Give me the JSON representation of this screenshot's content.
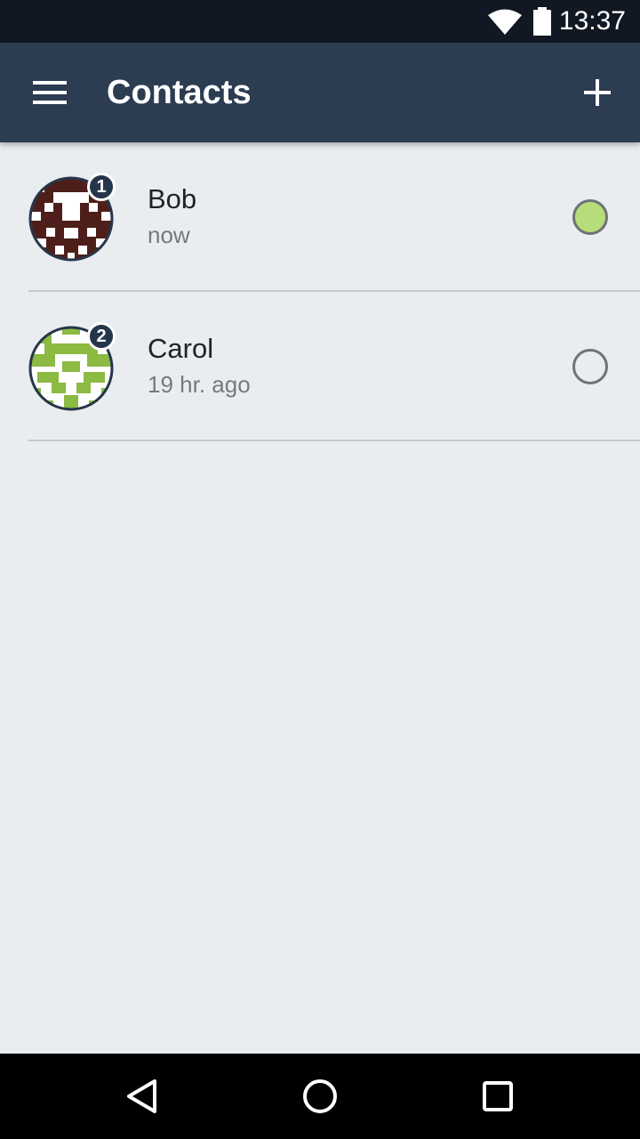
{
  "status_bar": {
    "time": "13:37",
    "icons": [
      "wifi-icon",
      "battery-icon"
    ]
  },
  "app_bar": {
    "title": "Contacts",
    "menu_icon": "hamburger-menu-icon",
    "add_icon": "plus-icon",
    "color": "#2c3c51"
  },
  "contacts": [
    {
      "name": "Bob",
      "last_seen": "now",
      "badge": "1",
      "online": true,
      "avatar_color": "#4e1f1a",
      "presence_color": "#b7dd7a"
    },
    {
      "name": "Carol",
      "last_seen": "19 hr. ago",
      "badge": "2",
      "online": false,
      "avatar_color": "#8cba43",
      "presence_color": "#e9edf0"
    }
  ],
  "nav_bar": {
    "buttons": [
      "back-icon",
      "home-icon",
      "recents-icon"
    ]
  }
}
